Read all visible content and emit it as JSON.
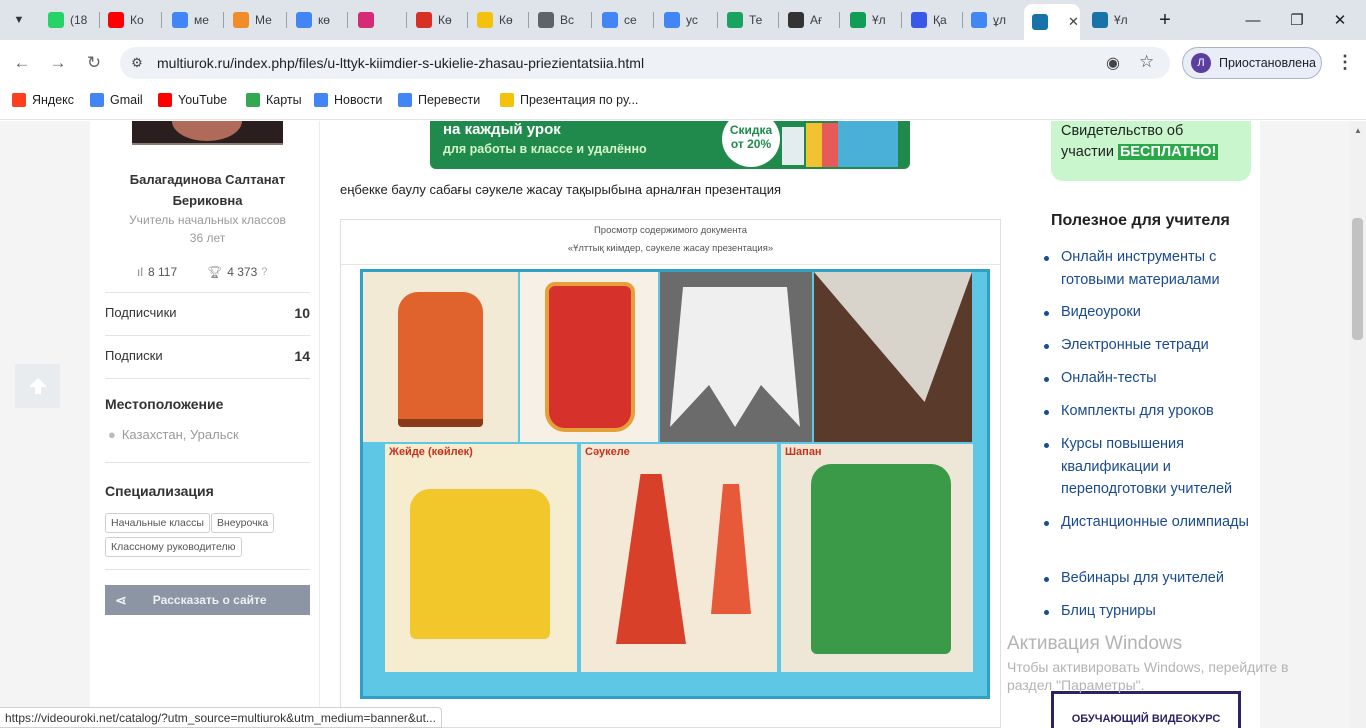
{
  "tabs": [
    {
      "label": "(18",
      "icon": "whatsapp-icon",
      "color": "#25d366"
    },
    {
      "label": "Ко",
      "icon": "youtube-icon",
      "color": "#ff0000"
    },
    {
      "label": "ме",
      "icon": "google-icon",
      "color": "#4285f4"
    },
    {
      "label": "Ме",
      "icon": "site-icon",
      "color": "#f28b2a"
    },
    {
      "label": "кө",
      "icon": "google-icon",
      "color": "#4285f4"
    },
    {
      "label": "",
      "icon": "instagram-icon",
      "color": "#d62976"
    },
    {
      "label": "Кө",
      "icon": "pdf-icon",
      "color": "#d93025"
    },
    {
      "label": "Кө",
      "icon": "bookmark-icon",
      "color": "#f4c20d"
    },
    {
      "label": "Вс",
      "icon": "globe-icon",
      "color": "#5f6368"
    },
    {
      "label": "се",
      "icon": "google-icon",
      "color": "#4285f4"
    },
    {
      "label": "ус",
      "icon": "google-icon",
      "color": "#4285f4"
    },
    {
      "label": "Те",
      "icon": "site-icon",
      "color": "#1aa260"
    },
    {
      "label": "Ағ",
      "icon": "wikipedia-icon",
      "color": "#333333"
    },
    {
      "label": "Ұл",
      "icon": "site-icon",
      "color": "#0f9d58"
    },
    {
      "label": "Қа",
      "icon": "wordpress-icon",
      "color": "#3858e9"
    },
    {
      "label": "ұл",
      "icon": "google-icon",
      "color": "#4285f4"
    },
    {
      "label": "",
      "icon": "book-icon",
      "color": "#1a73a8",
      "active": true
    },
    {
      "label": "Ұл",
      "icon": "book-icon",
      "color": "#1a73a8"
    }
  ],
  "address_bar": {
    "url": "multiurok.ru/index.php/files/u-lttyk-kiimdier-s-ukielie-zhasau-priezientatsiia.html"
  },
  "profile": {
    "initial": "Л",
    "label": "Приостановлена"
  },
  "bookmarks": [
    {
      "label": "Яндекс",
      "icon": "yandex-icon",
      "color": "#fc3f1d"
    },
    {
      "label": "Gmail",
      "icon": "google-icon",
      "color": "#4285f4"
    },
    {
      "label": "YouTube",
      "icon": "youtube-icon",
      "color": "#ff0000"
    },
    {
      "label": "Карты",
      "icon": "maps-icon",
      "color": "#34a853"
    },
    {
      "label": "Новости",
      "icon": "news-icon",
      "color": "#4285f4"
    },
    {
      "label": "Перевести",
      "icon": "translate-icon",
      "color": "#4285f4"
    },
    {
      "label": "Презентация по ру...",
      "icon": "bookmark-icon",
      "color": "#f4c20d"
    }
  ],
  "author": {
    "name_line1": "Балагадинова Салтанат",
    "name_line2": "Бериковна",
    "role": "Учитель начальных классов",
    "age": "36 лет",
    "views": "8 117",
    "awards": "4 373"
  },
  "stats": {
    "subscribers_label": "Подписчики",
    "subscribers": "10",
    "subscriptions_label": "Подписки",
    "subscriptions": "14"
  },
  "location": {
    "heading": "Местоположение",
    "value": "Казахстан, Уральск"
  },
  "specialization": {
    "heading": "Специализация",
    "tags": [
      "Начальные классы",
      "Внеурочка",
      "Классному руководителю"
    ]
  },
  "share_button": "Рассказать о сайте",
  "banner": {
    "line1": "на каждый урок",
    "line2": "для работы в классе и удалённо",
    "promo_line1": "Скидка",
    "promo_line2": "от 20%"
  },
  "description": "еңбекке баулу сабағы сәукеле жасау тақырыбына арналған презентация",
  "viewer": {
    "header": "Просмотр содержимого документа",
    "title": "«Ұлттық киімдер, сәукеле жасау презентация»"
  },
  "slide": {
    "labels": [
      "Жейде (көйлек)",
      "Сәукеле",
      "Шапан"
    ]
  },
  "certificate": {
    "line1": "Свидетельство об",
    "line2": "участии",
    "highlight": "БЕСПЛАТНО!"
  },
  "teacher_links": {
    "heading": "Полезное для учителя",
    "items": [
      "Онлайн инструменты с готовыми материалами",
      "Видеоуроки",
      "Электронные тетради",
      "Онлайн-тесты",
      "Комплекты для уроков",
      "Курсы повышения квалификации и переподготовки учителей",
      "Дистанционные олимпиады",
      "Вебинары для учителей",
      "Блиц турниры"
    ]
  },
  "windows_activation": {
    "title": "Активация Windows",
    "line1": "Чтобы активировать Windows, перейдите в",
    "line2": "раздел \"Параметры\"."
  },
  "video_button": "ОБУЧАЮЩИЙ ВИДЕОКУРС",
  "status_url": "https://videouroki.net/catalog/?utm_source=multiurok&utm_medium=banner&ut..."
}
